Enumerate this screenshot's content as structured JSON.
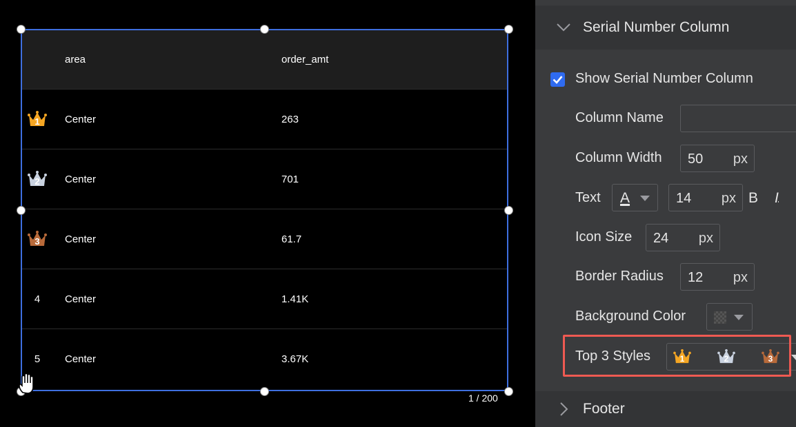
{
  "table": {
    "headers": {
      "area": "area",
      "amount": "order_amt"
    },
    "rows": [
      {
        "serial": "1",
        "area": "Center",
        "amount": "263"
      },
      {
        "serial": "2",
        "area": "Center",
        "amount": "701"
      },
      {
        "serial": "3",
        "area": "Center",
        "amount": "61.7"
      },
      {
        "serial": "4",
        "area": "Center",
        "amount": "1.41K"
      },
      {
        "serial": "5",
        "area": "Center",
        "amount": "3.67K"
      }
    ],
    "pagination": "1 / 200"
  },
  "colors": {
    "gold": "#f5a623",
    "silver": "#c9d2e0",
    "bronze": "#b86a3a",
    "selection": "#3e6fe0",
    "checkbox": "#2f6bf0",
    "highlight": "#ef5a52"
  },
  "panel": {
    "serial_section": {
      "title": "Serial Number Column",
      "expanded": true
    },
    "show_serial": {
      "label": "Show Serial Number Column",
      "checked": true
    },
    "column_name": {
      "label": "Column Name",
      "value": ""
    },
    "column_width": {
      "label": "Column Width",
      "value": "50",
      "unit": "px"
    },
    "text": {
      "label": "Text",
      "color_glyph": "A",
      "size": "14",
      "unit": "px",
      "bold": "B",
      "italic": "I"
    },
    "icon_size": {
      "label": "Icon Size",
      "value": "24",
      "unit": "px"
    },
    "border_radius": {
      "label": "Border Radius",
      "value": "12",
      "unit": "px"
    },
    "background_color": {
      "label": "Background Color"
    },
    "top3": {
      "label": "Top 3 Styles",
      "ranks": [
        "1",
        "2",
        "3"
      ]
    },
    "footer_section": {
      "title": "Footer",
      "expanded": false
    }
  }
}
